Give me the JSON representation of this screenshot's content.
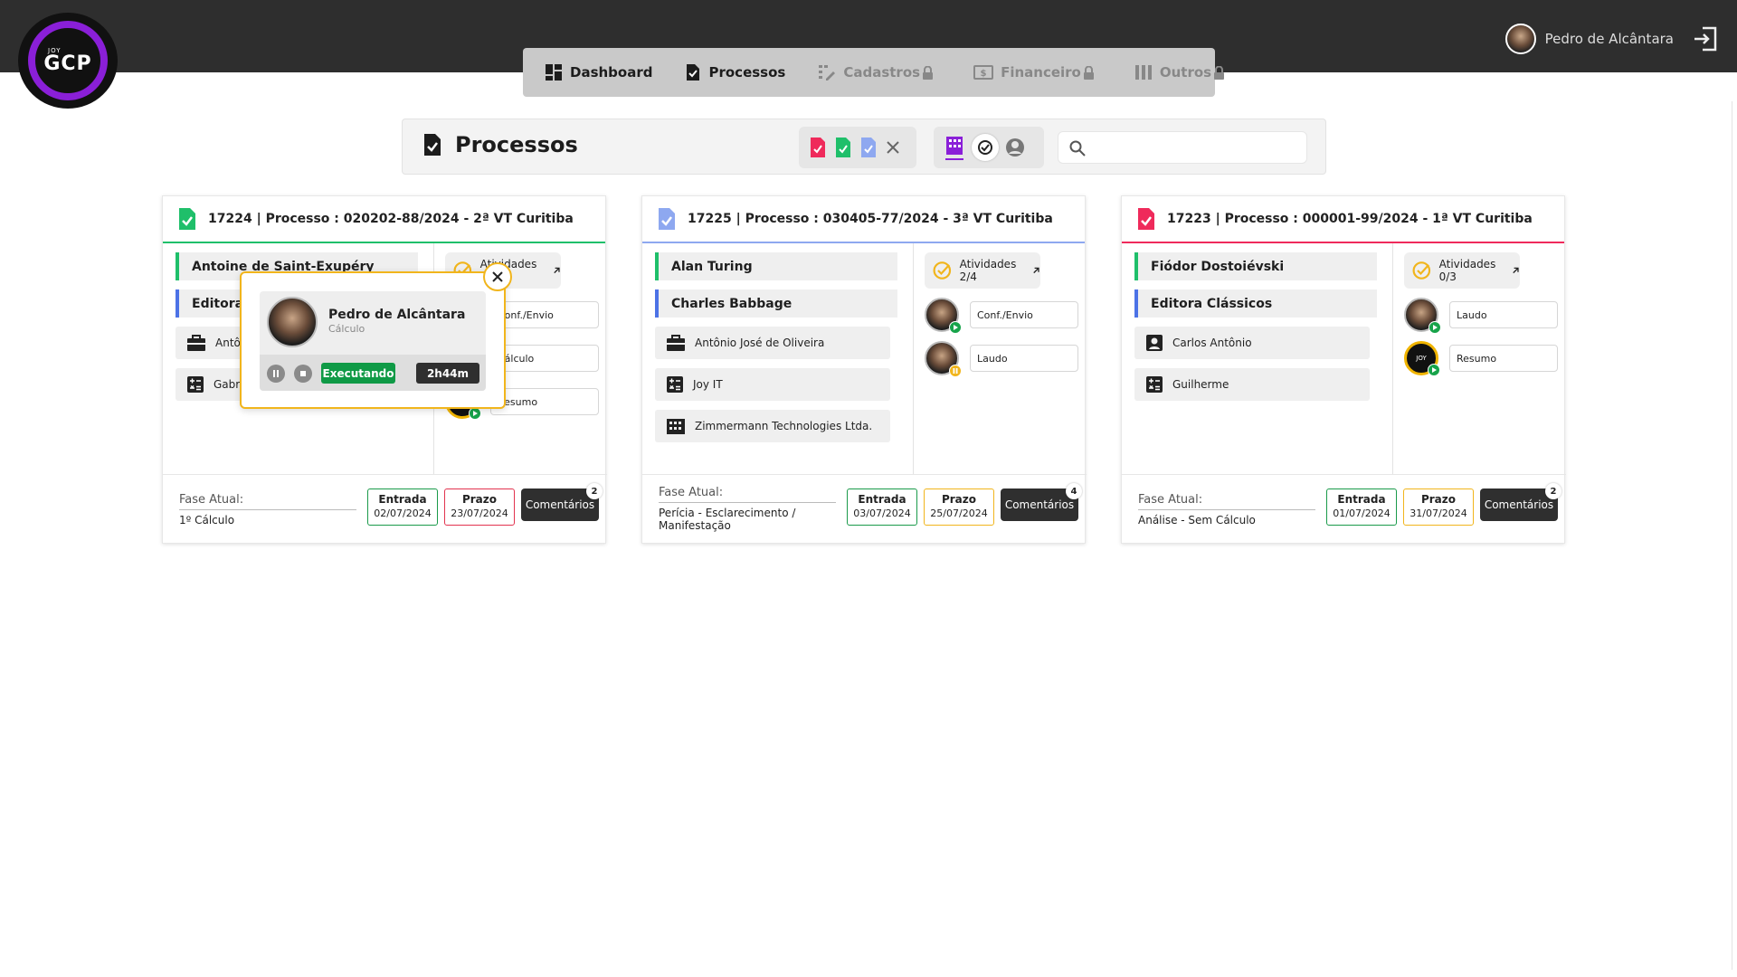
{
  "app": {
    "logo_top": "JOY",
    "logo_main": "GCP"
  },
  "nav": {
    "items": [
      {
        "label": "Dashboard",
        "locked": false,
        "icon": "dashboard-icon"
      },
      {
        "label": "Processos",
        "locked": false,
        "icon": "document-check-icon"
      },
      {
        "label": "Cadastros",
        "locked": true,
        "icon": "register-icon"
      },
      {
        "label": "Financeiro",
        "locked": true,
        "icon": "money-icon"
      },
      {
        "label": "Outros",
        "locked": true,
        "icon": "columns-icon"
      }
    ]
  },
  "user": {
    "name": "Pedro de Alcântara"
  },
  "toolbar": {
    "title": "Processos",
    "search_placeholder": "",
    "colors": {
      "red": "#ef2a5b",
      "green": "#1fbf6a",
      "blue": "#8ea8f0",
      "purple": "#8a1fd8"
    }
  },
  "cards": [
    {
      "header": "17224 | Processo : 020202-88/2024 - 2ª VT Curitiba",
      "status_color": "#1fbf6a",
      "parties": [
        "Antoine de Saint-Exupéry",
        "Editora M"
      ],
      "entities": [
        {
          "icon": "briefcase-icon",
          "label": "Antôn"
        },
        {
          "icon": "calculator-icon",
          "label": "Gabri"
        }
      ],
      "activities": "Atividades 1/5",
      "activity_rows": [
        "Conf./Envio",
        "Cálculo",
        "Resumo"
      ],
      "fase_label": "Fase Atual:",
      "fase_value": "1º Cálculo",
      "entrada_label": "Entrada",
      "entrada": "02/07/2024",
      "prazo_label": "Prazo",
      "prazo": "23/07/2024",
      "comments_label": "Comentários",
      "comments_count": "2"
    },
    {
      "header": "17225 | Processo : 030405-77/2024 - 3ª VT Curitiba",
      "status_color": "#8ea8f0",
      "parties": [
        "Alan Turing",
        "Charles Babbage"
      ],
      "entities": [
        {
          "icon": "briefcase-icon",
          "label": "Antônio José de Oliveira"
        },
        {
          "icon": "calculator-icon",
          "label": "Joy IT"
        },
        {
          "icon": "building-icon",
          "label": "Zimmermann Technologies Ltda."
        }
      ],
      "activities": "Atividades 2/4",
      "activity_rows": [
        "Conf./Envio",
        "Laudo"
      ],
      "fase_label": "Fase Atual:",
      "fase_value": "Perícia - Esclarecimento / Manifestação",
      "entrada_label": "Entrada",
      "entrada": "03/07/2024",
      "prazo_label": "Prazo",
      "prazo": "25/07/2024",
      "comments_label": "Comentários",
      "comments_count": "4"
    },
    {
      "header": "17223 | Processo : 000001-99/2024 - 1ª VT Curitiba",
      "status_color": "#ef2a5b",
      "parties": [
        "Fiódor Dostoiévski",
        "Editora Clássicos"
      ],
      "entities": [
        {
          "icon": "person-icon",
          "label": "Carlos Antônio"
        },
        {
          "icon": "calculator-icon",
          "label": "Guilherme"
        }
      ],
      "activities": "Atividades 0/3",
      "activity_rows": [
        "Laudo",
        "Resumo"
      ],
      "fase_label": "Fase Atual:",
      "fase_value": "Análise - Sem Cálculo",
      "entrada_label": "Entrada",
      "entrada": "01/07/2024",
      "prazo_label": "Prazo",
      "prazo": "31/07/2024",
      "comments_label": "Comentários",
      "comments_count": "2"
    }
  ],
  "popup": {
    "name": "Pedro de Alcântara",
    "role": "Cálculo",
    "status": "Executando",
    "timer": "2h44m"
  }
}
